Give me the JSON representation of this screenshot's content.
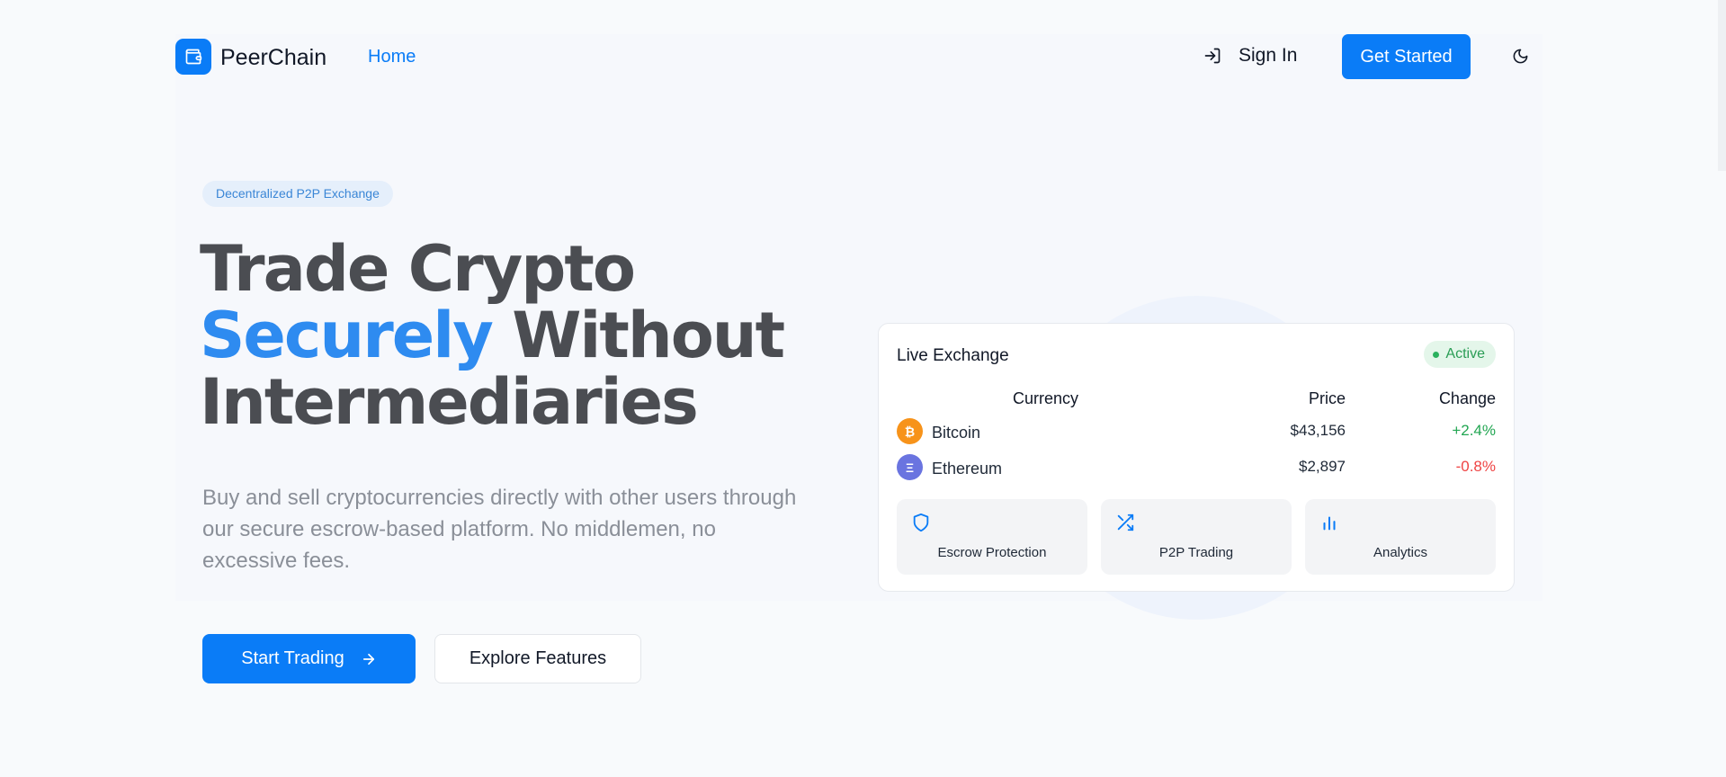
{
  "nav": {
    "brand": "PeerChain",
    "home": "Home",
    "sign_in": "Sign In",
    "get_started": "Get Started"
  },
  "hero": {
    "badge": "Decentralized P2P Exchange",
    "headline_line1": "Trade Crypto",
    "headline_accent": "Securely",
    "headline_rest": " Without",
    "headline_line3": "Intermediaries",
    "subtext": "Buy and sell cryptocurrencies directly with other users through our secure escrow-based platform. No middlemen, no excessive fees.",
    "start_trading": "Start Trading",
    "explore_features": "Explore Features"
  },
  "exchange": {
    "title": "Live Exchange",
    "status": "Active",
    "columns": {
      "currency": "Currency",
      "price": "Price",
      "change": "Change"
    },
    "rows": [
      {
        "symbol": "₿",
        "name": "Bitcoin",
        "price": "$43,156",
        "change": "+2.4%",
        "icon_color": "#f7931a",
        "change_color": "#22a652"
      },
      {
        "symbol": "Ξ",
        "name": "Ethereum",
        "price": "$2,897",
        "change": "-0.8%",
        "icon_color": "#6a74e0",
        "change_color": "#ef4444"
      }
    ],
    "features": [
      {
        "icon": "shield-icon",
        "label": "Escrow Protection"
      },
      {
        "icon": "shuffle-icon",
        "label": "P2P Trading"
      },
      {
        "icon": "bar-chart-icon",
        "label": "Analytics"
      }
    ]
  },
  "colors": {
    "accent": "#0a7cf7",
    "headline": "#4b4d52",
    "positive": "#22a652",
    "negative": "#ef4444"
  }
}
